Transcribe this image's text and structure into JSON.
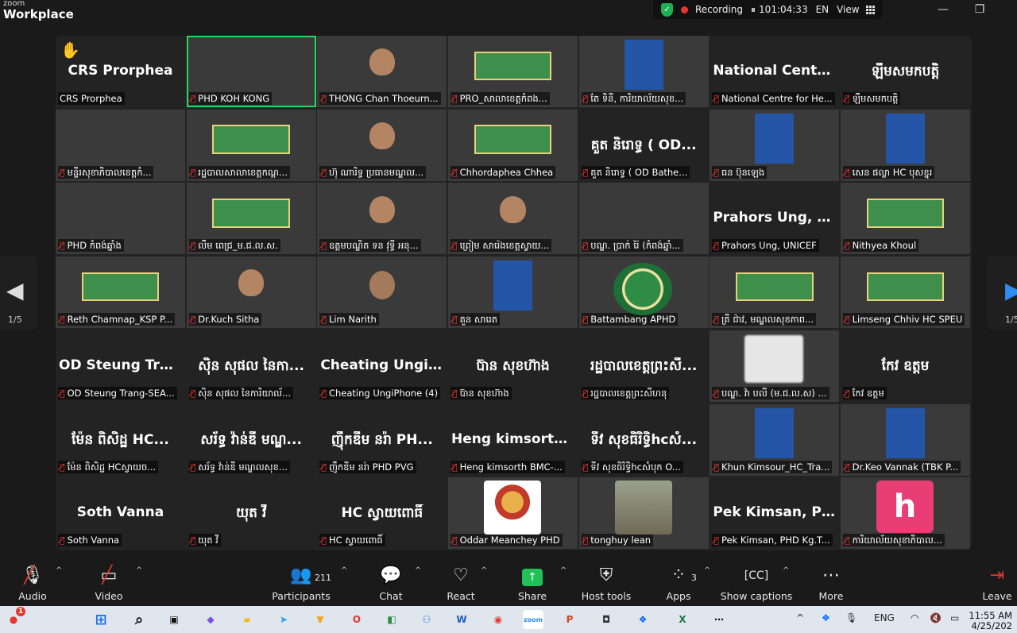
{
  "window": {
    "brand_top": "zoom",
    "brand_name": "Workplace",
    "recording": "Recording",
    "timer": "101:04:33",
    "language": "EN",
    "view": "View"
  },
  "pager": {
    "left": "1/5",
    "right": "1/5"
  },
  "tiles": [
    {
      "big": "CRS Prorphea",
      "label": "CRS Prorphea",
      "style": "plain",
      "hand": true,
      "muted": false
    },
    {
      "big": "",
      "label": "PHD KOH KONG",
      "style": "room",
      "muted": true,
      "active": true
    },
    {
      "big": "",
      "label": "THONG Chan Thoeurn...",
      "style": "person",
      "muted": true
    },
    {
      "big": "",
      "label": "PRO_សាលាខេត្តកំពង...",
      "style": "green",
      "muted": true
    },
    {
      "big": "",
      "label": "តែ ទិនី, ការិយាល័យសុខ...",
      "style": "blue",
      "muted": true
    },
    {
      "big": "National Centre...",
      "label": "National Centre for He...",
      "style": "plain",
      "muted": true
    },
    {
      "big": "ឡឹមសមកបត្តិ",
      "label": "ឡឹមសមកបត្តិ",
      "style": "plain",
      "muted": true
    },
    {
      "big": "",
      "label": "មន្ទីរសុខាភិបាលខេត្តកំ...",
      "style": "room",
      "muted": true
    },
    {
      "big": "",
      "label": "រដ្ឋបាលសាលាខេត្តកណ្ដ...",
      "style": "green",
      "muted": true
    },
    {
      "big": "",
      "label": "ហ៊ុ ណារិទ្ធ ប្រធានមណ្ឌល...",
      "style": "person",
      "muted": true
    },
    {
      "big": "",
      "label": "Chhordaphea Chhea",
      "style": "green",
      "muted": true
    },
    {
      "big": "គួត និរោទ្ធ ( OD...",
      "label": "គួត និរោទ្ធ ( OD Bathe...",
      "style": "plain",
      "muted": true
    },
    {
      "big": "",
      "label": "ធន ប៊ុនឡេង",
      "style": "blue",
      "muted": true
    },
    {
      "big": "",
      "label": "សេន ផល្លា HC បុសខ្នុរ",
      "style": "blue",
      "muted": true
    },
    {
      "big": "",
      "label": "PHD កំពង់ឆ្នាំង",
      "style": "flag",
      "muted": true
    },
    {
      "big": "",
      "label": "លឹម ពេជ្រ_ម.ជ.ល.ស.",
      "style": "green",
      "muted": true
    },
    {
      "big": "",
      "label": "ឧត្តមបណ្ឌិត ទន វុទ្ធី អនុ...",
      "style": "person",
      "muted": true
    },
    {
      "big": "",
      "label": "ព្រៀម សារ៉េង​ខេត្តស្វាយ...",
      "style": "person",
      "muted": true
    },
    {
      "big": "",
      "label": "បណ្ឌ. ប្រាក់ រ៉ៃ (កំពង់ឆ្នាំ...",
      "style": "flag",
      "muted": true
    },
    {
      "big": "Prahors Ung, U...",
      "label": "Prahors Ung, UNICEF",
      "style": "plain",
      "muted": true
    },
    {
      "big": "",
      "label": "Nithyea Khoul",
      "style": "green",
      "muted": true
    },
    {
      "big": "",
      "label": "Reth Chamnap_KSP P...",
      "style": "green",
      "muted": true
    },
    {
      "big": "",
      "label": "Dr.Kuch Sitha",
      "style": "person",
      "muted": true
    },
    {
      "big": "",
      "label": "Lim Narith",
      "style": "white",
      "muted": true
    },
    {
      "big": "",
      "label": "គួន សារេត",
      "style": "blue",
      "muted": true
    },
    {
      "big": "",
      "label": "Battambang APHD",
      "style": "emblem",
      "muted": true
    },
    {
      "big": "",
      "label": "គ្រី ជ៉ាវ, មណ្ឌលសុខភាព...",
      "style": "green",
      "muted": true
    },
    {
      "big": "",
      "label": "Limseng Chhiv HC SPEU",
      "style": "green",
      "muted": true
    },
    {
      "big": "OD Steung Tran...",
      "label": "OD Steung Trang-SEA...",
      "style": "plain",
      "muted": true
    },
    {
      "big": "ស៊ិន សុផល នៃកា...",
      "label": "ស៊ិន សុផល នៃការិយាល័...",
      "style": "plain",
      "muted": true
    },
    {
      "big": "Cheating UngiP...",
      "label": "Cheating UngiPhone (4)",
      "style": "plain",
      "muted": true
    },
    {
      "big": "ប៊ាន សុខហ៊ាង",
      "label": "ប៊ាន សុខហ៊ាង",
      "style": "plain",
      "muted": true
    },
    {
      "big": "រដ្ឋបាលខេត្តព្រះសី...",
      "label": "រដ្ឋបាលខេត្តព្រះសីហនុ",
      "style": "plain",
      "muted": true
    },
    {
      "big": "",
      "label": "បណ្ឌ. វ៉ា បលី (ម.ជ.ល.ស) ...",
      "style": "blur",
      "muted": true
    },
    {
      "big": "កែវ ឧត្តម",
      "label": "កែវ ឧត្តម",
      "style": "plain",
      "muted": true
    },
    {
      "big": "ម៉ែន ពិសិដ្ឋ HC...",
      "label": "ម៉ែន ពិសិដ្ឋ HCស្វាយច...",
      "style": "plain",
      "muted": true
    },
    {
      "big": "សរ័ទ្ធ វ៉ាន់ឌី មណ្ឌ...",
      "label": "សរ័ទ្ធ វ៉ាន់ឌី មណ្ឌលសុខ...",
      "style": "plain",
      "muted": true
    },
    {
      "big": "ញ៉ឹកឌីម នរ៉ា PH...",
      "label": "ញ៉ឹកឌីម នរ៉ា PHD PVG",
      "style": "plain",
      "muted": true
    },
    {
      "big": "Heng kimsorth...",
      "label": "Heng kimsorth BMC-...",
      "style": "plain",
      "muted": true
    },
    {
      "big": "ទីវ សុខធិរិទ្ធិhcសំ...",
      "label": "ទីវ សុខធិរិទ្ធិhcសំបុក O...",
      "style": "plain",
      "muted": true
    },
    {
      "big": "",
      "label": "Khun Kimsour_HC_Tra...",
      "style": "blue",
      "muted": true
    },
    {
      "big": "",
      "label": "Dr.Keo Vannak (TBK P...",
      "style": "blue",
      "muted": true
    },
    {
      "big": "Soth Vanna",
      "label": "Soth Vanna",
      "style": "plain",
      "muted": true
    },
    {
      "big": "យុត វី",
      "label": "យុត វី",
      "style": "plain",
      "muted": true
    },
    {
      "big": "HC ស្វាយពោធិ៍",
      "label": "HC ស្វាយពោធិ៍",
      "style": "plain",
      "muted": true
    },
    {
      "big": "",
      "label": "Oddar Meanchey PHD",
      "style": "deity",
      "muted": true
    },
    {
      "big": "",
      "label": "tonghuy lean",
      "style": "photo",
      "muted": true
    },
    {
      "big": "Pek Kimsan, PH...",
      "label": "Pek Kimsan, PHD Kg.T...",
      "style": "plain",
      "muted": true
    },
    {
      "big": "",
      "label": "ការិយាល័យសុខាភិបាល...",
      "style": "h",
      "avatar_letter": "h",
      "muted": true
    }
  ],
  "toolbar": {
    "audio": "Audio",
    "video": "Video",
    "participants": "Participants",
    "participants_count": "211",
    "chat": "Chat",
    "react": "React",
    "share": "Share",
    "host_tools": "Host tools",
    "apps": "Apps",
    "apps_count": "3",
    "captions": "Show captions",
    "more": "More",
    "leave": "Leave"
  },
  "taskbar": {
    "notif_badge": "1",
    "lang": "ENG",
    "time": "11:55 AM",
    "date": "4/25/202"
  }
}
